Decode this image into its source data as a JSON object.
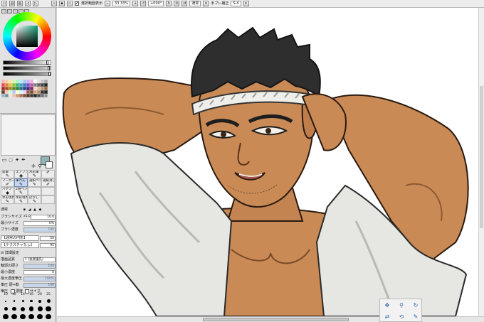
{
  "toolbar": {
    "checkbox_mark": "✔",
    "selection_label": "選択範囲表示",
    "zoom": "33.33%",
    "rotation": "+000°",
    "blend_mode": "通常",
    "stabilizer_label": "手ブレ補正",
    "stabilizer_value": "S-4"
  },
  "palette_colors": [
    "#f4b2b2",
    "#f4c8a8",
    "#f4e6a8",
    "#d8f0a8",
    "#a8f0c0",
    "#a8e8f0",
    "#a8c0f0",
    "#c8a8f0",
    "#f0a8e0",
    "#ffffff",
    "#e0e0e0",
    "#c0c0c0",
    "#a0a0a0",
    "#e05050",
    "#e08040",
    "#e0c040",
    "#90c040",
    "#40b070",
    "#40a0c0",
    "#4070c0",
    "#7050c0",
    "#c050a0",
    "#808080",
    "#606060",
    "#404040",
    "#202020",
    "#a02020",
    "#a05020",
    "#a08020",
    "#608020",
    "#208040",
    "#207080",
    "#204080",
    "#402080",
    "#802060",
    "#f0d8c0",
    "#d8b898",
    "#b89070",
    "#906040",
    "#604020",
    "#ffc0c0",
    "#c0ffc0",
    "#c0c0ff",
    "#ffffc0",
    "#c0ffff",
    "#ffc0ff",
    "#8b5a3c",
    "#6e4a36",
    "#d1a27a",
    "#b9876a",
    "#30302c",
    "#1e1e1e",
    "#9ab0c0",
    "#7090a0",
    "#f8e0d0",
    "#e8c0a8",
    "#c89478",
    "#a86e50",
    "#7a4a32",
    "#503020",
    "#3a3a3a",
    "#2a2a2a",
    "#505050",
    "#707070",
    "#909090"
  ],
  "brush_tools": [
    {
      "name": "鉛筆",
      "icon": "✎"
    },
    {
      "name": "エアブラシ",
      "icon": "◉"
    },
    {
      "name": "水彩筆",
      "icon": "✎"
    },
    {
      "name": "",
      "icon": "✐"
    },
    {
      "name": "マーカー",
      "icon": "✐"
    },
    {
      "name": "筆ぺん",
      "icon": "✎"
    },
    {
      "name": "選択ペン",
      "icon": "✎"
    },
    {
      "name": "選択消し",
      "icon": "✐"
    },
    {
      "name": "バケツ",
      "icon": "◆"
    },
    {
      "name": "2値ペン",
      "icon": "✎"
    },
    {
      "name": "",
      "icon": ""
    },
    {
      "name": "",
      "icon": ""
    },
    {
      "name": "水彩境界",
      "icon": "✎"
    },
    {
      "name": "水彩境界1",
      "icon": "✎"
    },
    {
      "name": "ぼかし",
      "icon": "✎"
    },
    {
      "name": "",
      "icon": ""
    }
  ],
  "brush_settings": {
    "mode_label": "通常",
    "brush_size_label": "ブラシサイズ",
    "brush_size_multiplier": "x1.0",
    "brush_size_value": "10.0",
    "min_size_label": "最小サイズ",
    "min_size_value": "0%",
    "density_label": "ブラシ濃度",
    "density_value": "100",
    "shape_dropdown": "【通常の円形】",
    "shape_value": "50",
    "texture_dropdown": "【テクスチャなし】",
    "texture_value": "95",
    "advanced_header": "詳細設定",
    "quality_label": "描画品質",
    "quality_value": "1 (速度優先)",
    "edge_hardness_label": "輪郭の硬さ",
    "edge_hardness_value": "100",
    "min_density_label": "最小濃度",
    "min_density_value": "0",
    "max_density_pressure_label": "最大濃度筆圧",
    "max_density_pressure_value": "100%",
    "pressure_label": "筆圧 硬↔軟",
    "pressure_value": "100",
    "pressure_density_label": "筆圧",
    "pressure_density_option": "濃度",
    "pressure_size_option": "サイズ"
  },
  "brush_sizes": {
    "labels": [
      "10",
      "12",
      "14",
      "16",
      "20",
      "25"
    ],
    "dot_rows": [
      [
        2,
        2.5,
        3,
        3.5,
        4,
        5
      ],
      [
        5,
        5.5,
        6,
        6.5,
        7,
        7.5
      ],
      [
        7.5,
        7.5,
        7.5,
        7.5,
        7.5,
        7.5
      ],
      [
        7.5,
        7.5,
        7.5,
        7.5,
        7.5,
        7.5
      ]
    ]
  },
  "colors": {
    "main_color": "#8fb5b2",
    "sub_color": "#ffffff",
    "bar_fill": "#9ab4d8"
  },
  "navigator_icons": [
    "scroll-icon",
    "zoom-icon",
    "rotate-icon",
    "flip-icon",
    "reset-icon",
    "pen-icon"
  ]
}
